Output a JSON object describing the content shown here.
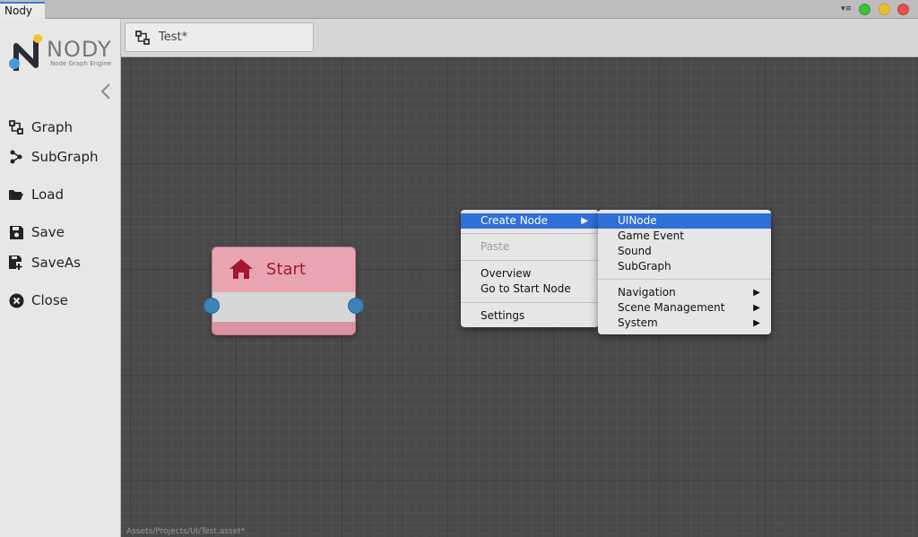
{
  "window": {
    "tab_title": "Nody",
    "menu_glyph": "▾≡",
    "buttons": {
      "green": "#3ec03e",
      "yellow": "#e8c22c",
      "red": "#e2514a"
    }
  },
  "sidebar": {
    "logo_text": "NODY",
    "logo_subtitle": "Node Graph Engine",
    "collapse_icon": "chevron-left-icon",
    "items": [
      {
        "label": "Graph",
        "icon": "graph-icon"
      },
      {
        "label": "SubGraph",
        "icon": "subgraph-icon"
      },
      {
        "label": "Load",
        "icon": "folder-open-icon"
      },
      {
        "label": "Save",
        "icon": "save-icon"
      },
      {
        "label": "SaveAs",
        "icon": "save-as-icon"
      },
      {
        "label": "Close",
        "icon": "close-circle-icon"
      }
    ]
  },
  "tabbar": {
    "tab_label": "Test*"
  },
  "canvas": {
    "path": "Assets/Projects/UI/Test.asset*",
    "start_node": {
      "title": "Start",
      "header_color": "#e8a4b0",
      "title_color": "#a31830"
    }
  },
  "context_menu": {
    "items": [
      {
        "label": "Create Node",
        "highlighted": true,
        "arrow": "▶"
      },
      {
        "label": "Paste",
        "disabled": true
      },
      {
        "label": "Overview"
      },
      {
        "label": "Go to Start Node"
      },
      {
        "label": "Settings"
      }
    ]
  },
  "submenu": {
    "items": [
      {
        "label": "UINode",
        "highlighted": true
      },
      {
        "label": "Game Event"
      },
      {
        "label": "Sound"
      },
      {
        "label": "SubGraph"
      },
      {
        "label": "Navigation",
        "arrow": "▶"
      },
      {
        "label": "Scene Management",
        "arrow": "▶"
      },
      {
        "label": "System",
        "arrow": "▶"
      }
    ]
  },
  "colors": {
    "highlight": "#2f6fd8",
    "canvas_bg": "#4a4a4a",
    "sidebar_bg": "#e7e7e7"
  }
}
